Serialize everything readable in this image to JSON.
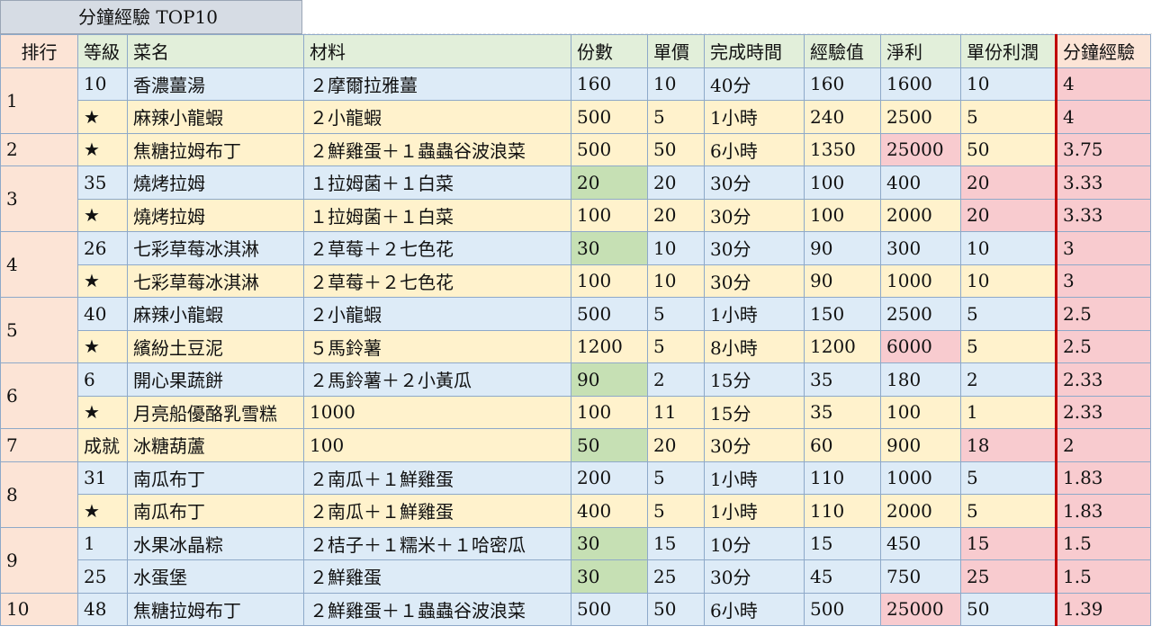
{
  "title": "分鐘經驗 TOP10",
  "headers": [
    "排行",
    "等級",
    "菜名",
    "材料",
    "份數",
    "單價",
    "完成時間",
    "經驗值",
    "淨利",
    "單份利潤",
    "分鐘經驗"
  ],
  "groups": [
    {
      "rank": "1",
      "rows": [
        {
          "lvl": "10",
          "name": "香濃薑湯",
          "mat": "２摩爾拉雅薑",
          "qty": "160",
          "price": "10",
          "time": "40分",
          "exp": "160",
          "profit": "1600",
          "unit": "10",
          "xp": "4",
          "color": "blue",
          "hl": []
        },
        {
          "lvl": "★",
          "name": "麻辣小龍蝦",
          "mat": "２小龍蝦",
          "qty": "500",
          "price": "5",
          "time": "1小時",
          "exp": "240",
          "profit": "2500",
          "unit": "5",
          "xp": "4",
          "color": "yellow",
          "hl": []
        }
      ]
    },
    {
      "rank": "2",
      "rows": [
        {
          "lvl": "★",
          "name": "焦糖拉姆布丁",
          "mat": "２鮮雞蛋＋１蟲蟲谷波浪菜",
          "qty": "500",
          "price": "50",
          "time": "6小時",
          "exp": "1350",
          "profit": "25000",
          "unit": "50",
          "xp": "3.75",
          "color": "yellow",
          "hl": [
            "profit"
          ]
        }
      ]
    },
    {
      "rank": "3",
      "rows": [
        {
          "lvl": "35",
          "name": "燒烤拉姆",
          "mat": "１拉姆菌＋１白菜",
          "qty": "20",
          "price": "20",
          "time": "30分",
          "exp": "100",
          "profit": "400",
          "unit": "20",
          "xp": "3.33",
          "color": "blue",
          "hl": [
            "qty",
            "unit"
          ]
        },
        {
          "lvl": "★",
          "name": "燒烤拉姆",
          "mat": "１拉姆菌＋１白菜",
          "qty": "100",
          "price": "20",
          "time": "30分",
          "exp": "100",
          "profit": "2000",
          "unit": "20",
          "xp": "3.33",
          "color": "yellow",
          "hl": [
            "unit"
          ]
        }
      ]
    },
    {
      "rank": "4",
      "rows": [
        {
          "lvl": "26",
          "name": "七彩草莓冰淇淋",
          "mat": "２草莓＋２七色花",
          "qty": "30",
          "price": "10",
          "time": "30分",
          "exp": "90",
          "profit": "300",
          "unit": "10",
          "xp": "3",
          "color": "blue",
          "hl": [
            "qty"
          ]
        },
        {
          "lvl": "★",
          "name": "七彩草莓冰淇淋",
          "mat": "２草莓＋２七色花",
          "qty": "100",
          "price": "10",
          "time": "30分",
          "exp": "90",
          "profit": "1000",
          "unit": "10",
          "xp": "3",
          "color": "yellow",
          "hl": []
        }
      ]
    },
    {
      "rank": "5",
      "rows": [
        {
          "lvl": "40",
          "name": "麻辣小龍蝦",
          "mat": "２小龍蝦",
          "qty": "500",
          "price": "5",
          "time": "1小時",
          "exp": "150",
          "profit": "2500",
          "unit": "5",
          "xp": "2.5",
          "color": "blue",
          "hl": []
        },
        {
          "lvl": "★",
          "name": "繽紛土豆泥",
          "mat": "５馬鈴薯",
          "qty": "1200",
          "price": "5",
          "time": "8小時",
          "exp": "1200",
          "profit": "6000",
          "unit": "5",
          "xp": "2.5",
          "color": "yellow",
          "hl": [
            "profit"
          ]
        }
      ]
    },
    {
      "rank": "6",
      "rows": [
        {
          "lvl": "6",
          "name": "開心果蔬餅",
          "mat": "２馬鈴薯＋２小黃瓜",
          "qty": "90",
          "price": "2",
          "time": "15分",
          "exp": "35",
          "profit": "180",
          "unit": "2",
          "xp": "2.33",
          "color": "blue",
          "hl": [
            "qty"
          ]
        },
        {
          "lvl": "★",
          "name": "月亮船優酪乳雪糕",
          "mat": "1000",
          "qty": "100",
          "price": "11",
          "time": "15分",
          "exp": "35",
          "profit": "100",
          "unit": "1",
          "xp": "2.33",
          "color": "yellow",
          "hl": []
        }
      ]
    },
    {
      "rank": "7",
      "rows": [
        {
          "lvl": "成就",
          "name": "冰糖葫蘆",
          "mat": "100",
          "qty": "50",
          "price": "20",
          "time": "30分",
          "exp": "60",
          "profit": "900",
          "unit": "18",
          "xp": "2",
          "color": "yellow",
          "hl": [
            "qty",
            "unit"
          ]
        }
      ]
    },
    {
      "rank": "8",
      "rows": [
        {
          "lvl": "31",
          "name": "南瓜布丁",
          "mat": "２南瓜＋１鮮雞蛋",
          "qty": "200",
          "price": "5",
          "time": "1小時",
          "exp": "110",
          "profit": "1000",
          "unit": "5",
          "xp": "1.83",
          "color": "blue",
          "hl": []
        },
        {
          "lvl": "★",
          "name": "南瓜布丁",
          "mat": "２南瓜＋１鮮雞蛋",
          "qty": "400",
          "price": "5",
          "time": "1小時",
          "exp": "110",
          "profit": "2000",
          "unit": "5",
          "xp": "1.83",
          "color": "yellow",
          "hl": []
        }
      ]
    },
    {
      "rank": "9",
      "rows": [
        {
          "lvl": "1",
          "name": "水果冰晶粽",
          "mat": "２桔子＋１糯米＋１哈密瓜",
          "qty": "30",
          "price": "15",
          "time": "10分",
          "exp": "15",
          "profit": "450",
          "unit": "15",
          "xp": "1.5",
          "color": "blue",
          "hl": [
            "qty",
            "unit"
          ]
        },
        {
          "lvl": "25",
          "name": "水蛋堡",
          "mat": "２鮮雞蛋",
          "qty": "30",
          "price": "25",
          "time": "30分",
          "exp": "45",
          "profit": "750",
          "unit": "25",
          "xp": "1.5",
          "color": "blue",
          "hl": [
            "qty",
            "unit"
          ]
        }
      ]
    },
    {
      "rank": "10",
      "rows": [
        {
          "lvl": "48",
          "name": "焦糖拉姆布丁",
          "mat": "２鮮雞蛋＋１蟲蟲谷波浪菜",
          "qty": "500",
          "price": "50",
          "time": "6小時",
          "exp": "500",
          "profit": "25000",
          "unit": "50",
          "xp": "1.39",
          "color": "blue",
          "hl": [
            "profit"
          ]
        }
      ]
    }
  ]
}
